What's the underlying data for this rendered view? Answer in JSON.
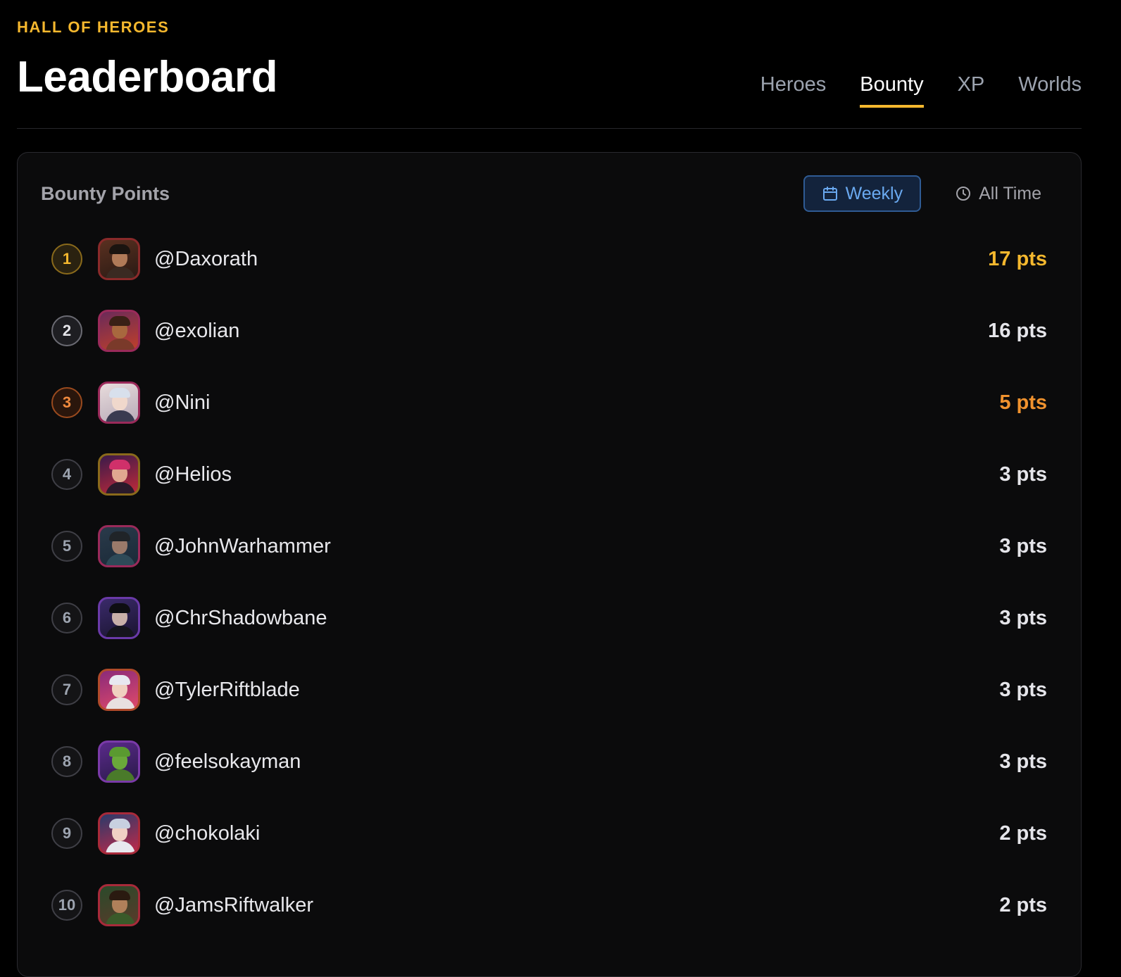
{
  "header": {
    "eyebrow": "HALL OF HEROES",
    "title": "Leaderboard",
    "tabs": [
      {
        "label": "Heroes"
      },
      {
        "label": "Bounty"
      },
      {
        "label": "XP"
      },
      {
        "label": "Worlds"
      }
    ],
    "active_tab": "Bounty"
  },
  "panel": {
    "title": "Bounty Points",
    "toggle": {
      "weekly_label": "Weekly",
      "weekly_icon": "calendar-icon",
      "alltime_label": "All Time",
      "alltime_icon": "clock-icon",
      "selected": "Weekly"
    },
    "rows": [
      {
        "rank": "1",
        "username": "@Daxorath",
        "points": "17 pts"
      },
      {
        "rank": "2",
        "username": "@exolian",
        "points": "16 pts"
      },
      {
        "rank": "3",
        "username": "@Nini",
        "points": "5 pts"
      },
      {
        "rank": "4",
        "username": "@Helios",
        "points": "3 pts"
      },
      {
        "rank": "5",
        "username": "@JohnWarhammer",
        "points": "3 pts"
      },
      {
        "rank": "6",
        "username": "@ChrShadowbane",
        "points": "3 pts"
      },
      {
        "rank": "7",
        "username": "@TylerRiftblade",
        "points": "3 pts"
      },
      {
        "rank": "8",
        "username": "@feelsokayman",
        "points": "3 pts"
      },
      {
        "rank": "9",
        "username": "@chokolaki",
        "points": "2 pts"
      },
      {
        "rank": "10",
        "username": "@JamsRiftwalker",
        "points": "2 pts"
      }
    ]
  },
  "colors": {
    "accent_gold": "#f5b82e",
    "accent_bronze": "#f0922e",
    "accent_blue": "#6aa9f0",
    "background": "#000000",
    "panel": "#0b0b0c"
  }
}
